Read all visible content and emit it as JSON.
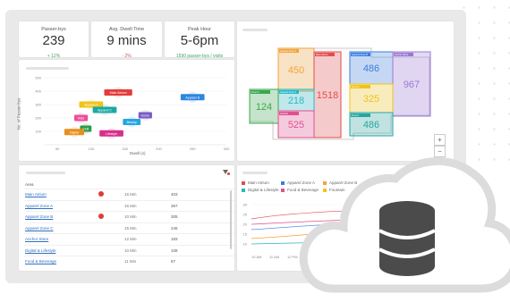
{
  "kpis": [
    {
      "label": "Passer-bys",
      "value": "239",
      "delta": "+ 12%",
      "delta_color": "#3aa766"
    },
    {
      "label": "Avg. Dwell Time",
      "value": "9 mins",
      "delta": "- 2%",
      "delta_color": "#e04a4a"
    },
    {
      "label": "Peak Hour",
      "value": "5-6pm",
      "delta": "1590 passer-bys / visits",
      "delta_color": "#3aa766"
    }
  ],
  "scatter": {
    "ylabel": "No. of Passer-bys",
    "xlabel": "Dwell (s)",
    "x_ticks": [
      "50",
      "100",
      "150",
      "200",
      "250",
      "300"
    ],
    "y_ticks": [
      "500",
      "400",
      "300",
      "200",
      "100"
    ]
  },
  "chart_data": {
    "type": "scatter",
    "xlabel": "Dwell (s)",
    "ylabel": "No. of Passer-bys",
    "xlim": [
      30,
      300
    ],
    "ylim": [
      0,
      500
    ],
    "points": [
      {
        "label": "Main Atrium",
        "x": 140,
        "y": 390,
        "color": "#e33c3c"
      },
      {
        "label": "Apparel B",
        "x": 250,
        "y": 355,
        "color": "#2e86de"
      },
      {
        "label": "Apparel A",
        "x": 100,
        "y": 300,
        "color": "#f0c419"
      },
      {
        "label": "Apparel C",
        "x": 120,
        "y": 260,
        "color": "#1aa9a2"
      },
      {
        "label": "Kids",
        "x": 85,
        "y": 200,
        "color": "#ec4f9a"
      },
      {
        "label": "Home",
        "x": 180,
        "y": 220,
        "color": "#7a5bc2"
      },
      {
        "label": "Beauty",
        "x": 160,
        "y": 170,
        "color": "#27a6e0"
      },
      {
        "label": "F&B",
        "x": 92,
        "y": 120,
        "color": "#2e9a4a"
      },
      {
        "label": "Digital",
        "x": 75,
        "y": 95,
        "color": "#e88f1c"
      },
      {
        "label": "Lifestyle",
        "x": 130,
        "y": 85,
        "color": "#d62f8c"
      }
    ]
  },
  "floormap": {
    "zones": [
      {
        "name": "Apparel Zone A",
        "value": "450",
        "color": "#f2a33a"
      },
      {
        "name": "Main Atrium",
        "value": "1518",
        "color": "#e44c4c"
      },
      {
        "name": "Apparel Zone B",
        "value": "486",
        "color": "#3a7ee0"
      },
      {
        "name": "Anchor Store",
        "value": "967",
        "color": "#9a78d6"
      },
      {
        "name": "Apparel Zone C",
        "value": "218",
        "color": "#28b8c6"
      },
      {
        "name": "Zone D",
        "value": "124",
        "color": "#39a84f"
      },
      {
        "name": "Fashion",
        "value": "525",
        "color": "#e14f8e"
      },
      {
        "name": "Zone E",
        "value": "325",
        "color": "#f0c419"
      },
      {
        "name": "Zone F",
        "value": "486",
        "color": "#27a6a0"
      }
    ],
    "zoom_in": "+",
    "zoom_out": "−"
  },
  "table": {
    "header": "Area",
    "rows": [
      {
        "area": "Main Atrium",
        "time": "15 Min",
        "count": "403",
        "alert": true
      },
      {
        "area": "Apparel Zone A",
        "time": "15 Min",
        "count": "367",
        "alert": false
      },
      {
        "area": "Apparel Zone B",
        "time": "10 Min",
        "count": "305",
        "alert": true
      },
      {
        "area": "Apparel Zone C",
        "time": "15 Min",
        "count": "246",
        "alert": false
      },
      {
        "area": "Anchor Store",
        "time": "12 Min",
        "count": "183",
        "alert": false
      },
      {
        "area": "Digital & Lifestyle",
        "time": "10 Min",
        "count": "108",
        "alert": false
      },
      {
        "area": "Food & Beverage",
        "time": "11 Min",
        "count": "57",
        "alert": false
      }
    ]
  },
  "linechart": {
    "legend": [
      {
        "name": "Main Atrium",
        "color": "#e44c4c"
      },
      {
        "name": "Apparel Zone A",
        "color": "#3a7ee0"
      },
      {
        "name": "Apparel Zone B",
        "color": "#f2a33a"
      },
      {
        "name": "Digital & Lifestyle",
        "color": "#28b8c6"
      },
      {
        "name": "Food & Beverage",
        "color": "#e14f8e"
      },
      {
        "name": "Fountain",
        "color": "#f0c419"
      }
    ],
    "y_ticks": [
      "30",
      "25",
      "20",
      "15",
      "10"
    ],
    "x_ticks": [
      "10 AM",
      "11 AM",
      "12 PM"
    ]
  }
}
